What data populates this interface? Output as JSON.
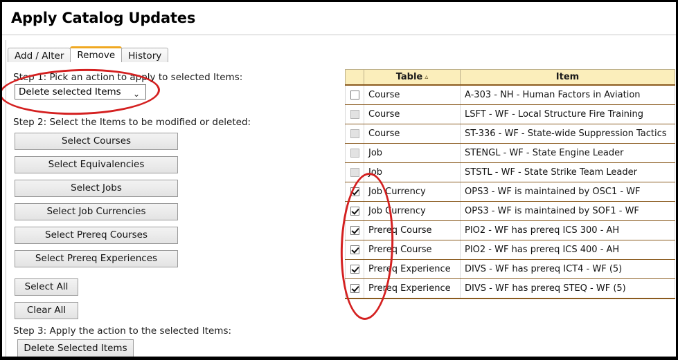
{
  "page": {
    "title": "Apply Catalog Updates"
  },
  "tabs": [
    {
      "label": "Add / Alter",
      "active": false
    },
    {
      "label": "Remove",
      "active": true
    },
    {
      "label": "History",
      "active": false
    }
  ],
  "left_panel": {
    "step1_label": "Step 1: Pick an action to apply to selected Items:",
    "action_select": {
      "value": "Delete selected Items",
      "caret": "⌄"
    },
    "step2_label": "Step 2: Select the Items to be modified or deleted:",
    "select_buttons": [
      "Select Courses",
      "Select Equivalencies",
      "Select Jobs",
      "Select Job Currencies",
      "Select Prereq Courses",
      "Select Prereq Experiences"
    ],
    "bulk_buttons": [
      "Select All",
      "Clear All"
    ],
    "step3_label": "Step 3: Apply the action to the selected Items:",
    "apply_button": "Delete Selected Items"
  },
  "table": {
    "headers": {
      "check": "",
      "table": "Table",
      "item": "Item",
      "sort_caret": "▵"
    },
    "rows": [
      {
        "checked": false,
        "disabled": false,
        "table": "Course",
        "item": "A-303 - NH - Human Factors in Aviation"
      },
      {
        "checked": false,
        "disabled": true,
        "table": "Course",
        "item": "LSFT - WF - Local Structure Fire Training"
      },
      {
        "checked": false,
        "disabled": true,
        "table": "Course",
        "item": "ST-336 - WF - State-wide Suppression Tactics"
      },
      {
        "checked": false,
        "disabled": true,
        "table": "Job",
        "item": "STENGL - WF - State Engine Leader"
      },
      {
        "checked": false,
        "disabled": true,
        "table": "Job",
        "item": "STSTL - WF - State Strike Team Leader"
      },
      {
        "checked": true,
        "disabled": false,
        "table": "Job Currency",
        "item": "OPS3 - WF is maintained by OSC1 - WF"
      },
      {
        "checked": true,
        "disabled": false,
        "table": "Job Currency",
        "item": "OPS3 - WF is maintained by SOF1 - WF"
      },
      {
        "checked": true,
        "disabled": false,
        "table": "Prereq Course",
        "item": "PIO2 - WF has prereq ICS 300 - AH"
      },
      {
        "checked": true,
        "disabled": false,
        "table": "Prereq Course",
        "item": "PIO2 - WF has prereq ICS 400 - AH"
      },
      {
        "checked": true,
        "disabled": false,
        "table": "Prereq Experience",
        "item": "DIVS - WF has prereq ICT4 - WF (5)"
      },
      {
        "checked": true,
        "disabled": false,
        "table": "Prereq Experience",
        "item": "DIVS - WF has prereq STEQ - WF (5)"
      }
    ]
  },
  "annotations": {
    "accent_color": "#d42020",
    "ellipses": [
      {
        "name": "dropdown-highlight"
      },
      {
        "name": "checkbox-column-highlight"
      }
    ]
  },
  "colors": {
    "tab_active_accent": "#f0a821",
    "table_header_bg": "#fbeebb",
    "table_row_border": "#8a5a1e"
  }
}
